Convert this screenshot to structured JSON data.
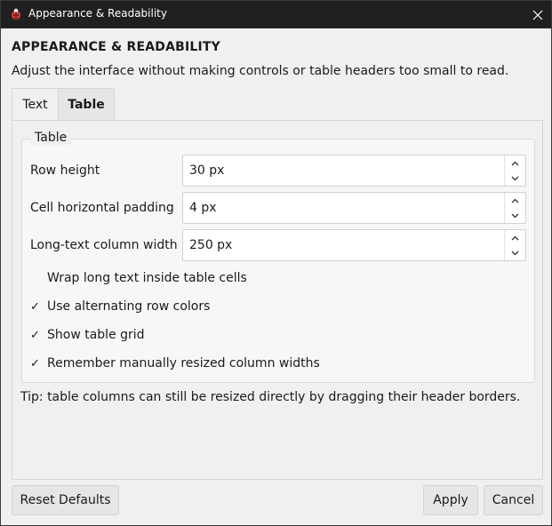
{
  "window": {
    "title": "Appearance & Readability",
    "close_icon": "close-icon",
    "app_icon": "ladybug-icon"
  },
  "dialog": {
    "heading": "APPEARANCE & READABILITY",
    "subtitle": "Adjust the interface without making controls or table headers too small to read."
  },
  "tabs": [
    {
      "label": "Text",
      "selected": false
    },
    {
      "label": "Table",
      "selected": true
    }
  ],
  "table_group": {
    "title": "Table",
    "fields": [
      {
        "label": "Row height",
        "value": "30 px"
      },
      {
        "label": "Cell horizontal padding",
        "value": "4 px"
      },
      {
        "label": "Long-text column width",
        "value": "250 px"
      }
    ],
    "checkboxes": [
      {
        "label": "Wrap long text inside table cells",
        "checked": false,
        "mark": ""
      },
      {
        "label": "Use alternating row colors",
        "checked": true,
        "mark": "✓"
      },
      {
        "label": "Show table grid",
        "checked": true,
        "mark": "✓"
      },
      {
        "label": "Remember manually resized column widths",
        "checked": true,
        "mark": "✓"
      }
    ]
  },
  "tip": "Tip: table columns can still be resized directly by dragging their header borders.",
  "buttons": {
    "reset": "Reset Defaults",
    "apply": "Apply",
    "cancel": "Cancel"
  },
  "colors": {
    "titlebar": "#202020",
    "dialog_bg": "#f0f0f0",
    "icon_red": "#e03a3a"
  }
}
